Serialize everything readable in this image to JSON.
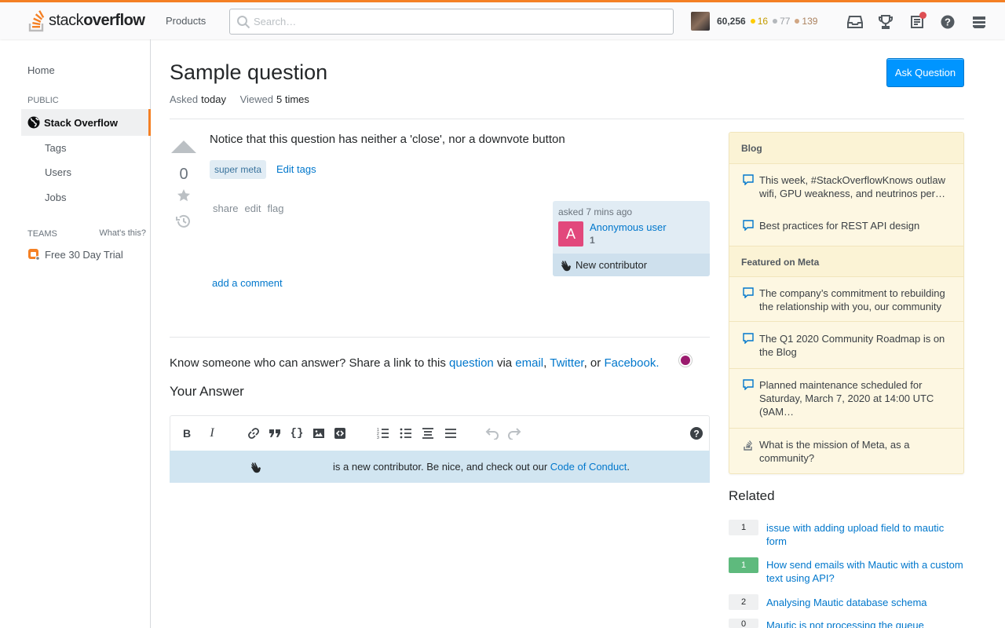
{
  "header": {
    "logo_plain": "stack",
    "logo_bold": "overflow",
    "products_label": "Products",
    "search_placeholder": "Search…",
    "reputation": "60,256",
    "badges": {
      "gold": {
        "count": "16",
        "color": "#ffcc01"
      },
      "silver": {
        "count": "77",
        "color": "#b4b8bc"
      },
      "bronze": {
        "count": "139",
        "color": "#d1a684"
      }
    },
    "icons": [
      "inbox-icon",
      "achievements-icon",
      "review-icon",
      "help-icon",
      "site-switcher-icon"
    ]
  },
  "leftnav": {
    "home": "Home",
    "public_label": "PUBLIC",
    "active_item": "Stack Overflow",
    "tags": "Tags",
    "users": "Users",
    "jobs": "Jobs",
    "teams_label": "TEAMS",
    "whats_this": "What's this?",
    "trial": "Free 30 Day Trial"
  },
  "question": {
    "title": "Sample question",
    "asked_label": "Asked",
    "asked_value": "today",
    "viewed_label": "Viewed",
    "viewed_value": "5 times",
    "ask_button": "Ask Question",
    "votes": "0",
    "body": "Notice that this question has neither a 'close', nor a downvote button",
    "tag": "super meta",
    "edit_tags": "Edit tags",
    "menu": {
      "share": "share",
      "edit": "edit",
      "flag": "flag"
    },
    "owner": {
      "asked_time": "asked 7 mins ago",
      "avatar_letter": "A",
      "name": "Anonymous user",
      "rep": "1",
      "contributor_label": "New contributor"
    },
    "add_comment": "add a comment"
  },
  "share": {
    "prefix": "Know someone who can answer? Share a link to this",
    "question_link": "question",
    "via": "via",
    "email": "email",
    "comma1": ",",
    "twitter": "Twitter",
    "or": ", or",
    "facebook": "Facebook."
  },
  "answer": {
    "title": "Your Answer",
    "new_contributor_text": "is a new contributor. Be nice, and check out our",
    "coc_link": "Code of Conduct",
    "coc_end": "."
  },
  "sidebar": {
    "blog_header": "Blog",
    "blog_items": [
      "This week, #StackOverflowKnows outlaw wifi, GPU weakness, and neutrinos per…",
      "Best practices for REST API design"
    ],
    "meta_header": "Featured on Meta",
    "meta_items": [
      "The company’s commitment to rebuilding the relationship with you, our community",
      "The Q1 2020 Community Roadmap is on the Blog",
      "Planned maintenance scheduled for Saturday, March 7, 2020 at 14:00 UTC (9AM…",
      "What is the mission of Meta, as a community?"
    ]
  },
  "related": {
    "title": "Related",
    "items": [
      {
        "count": "1",
        "text": "issue with adding upload field to mautic form",
        "answered": false
      },
      {
        "count": "1",
        "text": "How send emails with Mautic with a custom text using API?",
        "answered": true
      },
      {
        "count": "2",
        "text": "Analysing Mautic database schema",
        "answered": false
      },
      {
        "count": "0",
        "text": "Mautic is not processing the queue",
        "answered": false
      }
    ]
  }
}
